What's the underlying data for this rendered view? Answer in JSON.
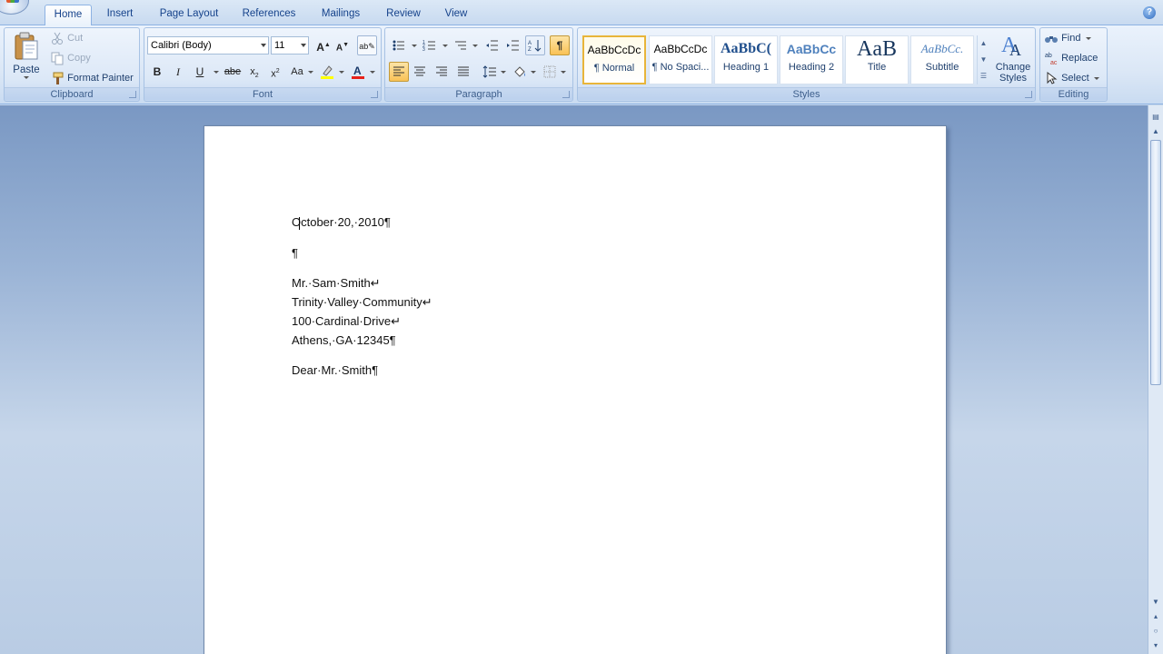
{
  "tabs": [
    "Home",
    "Insert",
    "Page Layout",
    "References",
    "Mailings",
    "Review",
    "View"
  ],
  "active_tab": "Home",
  "clipboard": {
    "paste": "Paste",
    "cut": "Cut",
    "copy": "Copy",
    "format_painter": "Format Painter",
    "label": "Clipboard"
  },
  "font": {
    "name": "Calibri (Body)",
    "size": "11",
    "label": "Font"
  },
  "paragraph": {
    "label": "Paragraph"
  },
  "styles": {
    "label": "Styles",
    "items": [
      {
        "sample": "AaBbCcDc",
        "name": "¶ Normal"
      },
      {
        "sample": "AaBbCcDc",
        "name": "¶ No Spaci..."
      },
      {
        "sample": "AaBbC(",
        "name": "Heading 1"
      },
      {
        "sample": "AaBbCc",
        "name": "Heading 2"
      },
      {
        "sample": "AaB",
        "name": "Title"
      },
      {
        "sample": "AaBbCc.",
        "name": "Subtitle"
      }
    ],
    "change_styles": "Change Styles"
  },
  "editing": {
    "find": "Find",
    "replace": "Replace",
    "select": "Select",
    "label": "Editing"
  },
  "document": {
    "date": "October·20,·2010¶",
    "blank": "¶",
    "addr1": "Mr.·Sam·Smith↵",
    "addr2": "Trinity·Valley·Community↵",
    "addr3": "100·Cardinal·Drive↵",
    "addr4": "Athens,·GA·12345¶",
    "greeting": "Dear·Mr.·Smith¶"
  },
  "colors": {
    "highlight": "#ffff00",
    "font_color": "#e8221a",
    "accent": "#f9c256"
  }
}
